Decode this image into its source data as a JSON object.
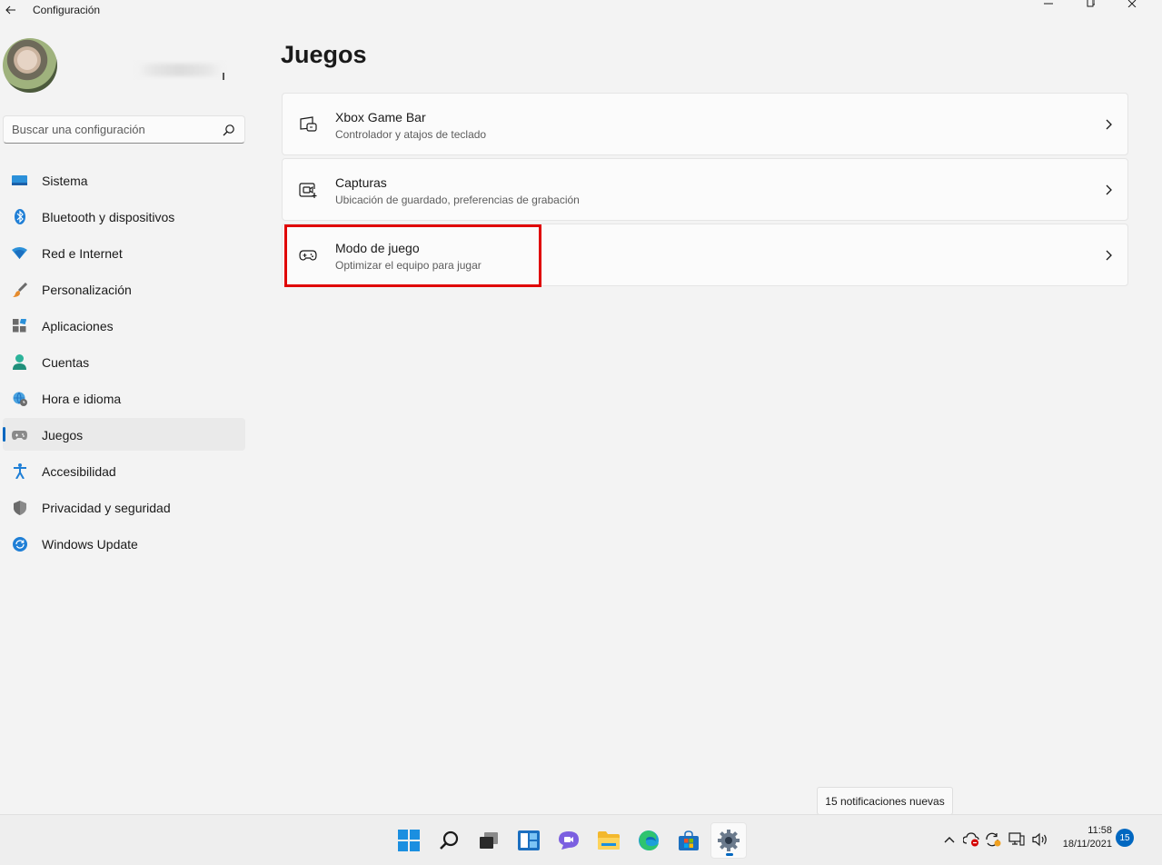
{
  "window": {
    "title": "Configuración"
  },
  "search": {
    "placeholder": "Buscar una configuración"
  },
  "sidebar": {
    "items": [
      {
        "label": "Sistema",
        "icon": "monitor-icon"
      },
      {
        "label": "Bluetooth y dispositivos",
        "icon": "bluetooth-icon"
      },
      {
        "label": "Red e Internet",
        "icon": "wifi-icon"
      },
      {
        "label": "Personalización",
        "icon": "brush-icon"
      },
      {
        "label": "Aplicaciones",
        "icon": "apps-icon"
      },
      {
        "label": "Cuentas",
        "icon": "person-icon"
      },
      {
        "label": "Hora e idioma",
        "icon": "globe-clock-icon"
      },
      {
        "label": "Juegos",
        "icon": "gamepad-icon",
        "active": true
      },
      {
        "label": "Accesibilidad",
        "icon": "accessibility-icon"
      },
      {
        "label": "Privacidad y seguridad",
        "icon": "shield-icon"
      },
      {
        "label": "Windows Update",
        "icon": "update-icon"
      }
    ]
  },
  "main": {
    "title": "Juegos",
    "cards": [
      {
        "title": "Xbox Game Bar",
        "subtitle": "Controlador y atajos de teclado",
        "icon": "game-bar-icon"
      },
      {
        "title": "Capturas",
        "subtitle": "Ubicación de guardado, preferencias de grabación",
        "icon": "capture-icon"
      },
      {
        "title": "Modo de juego",
        "subtitle": "Optimizar el equipo para jugar",
        "icon": "gamepad-icon",
        "highlighted": true
      }
    ]
  },
  "notification": {
    "text": "15 notificaciones nuevas"
  },
  "taskbar": {
    "apps": [
      "start-icon",
      "search-icon",
      "task-view-icon",
      "widgets-icon",
      "chat-icon",
      "file-explorer-icon",
      "edge-icon",
      "store-icon",
      "settings-icon"
    ],
    "clock": {
      "time": "11:58",
      "date": "18/11/2021"
    },
    "badge": "15"
  },
  "colors": {
    "accent": "#0067c0",
    "highlight": "#e00000",
    "background": "#f3f3f3",
    "card": "#fbfbfb"
  }
}
